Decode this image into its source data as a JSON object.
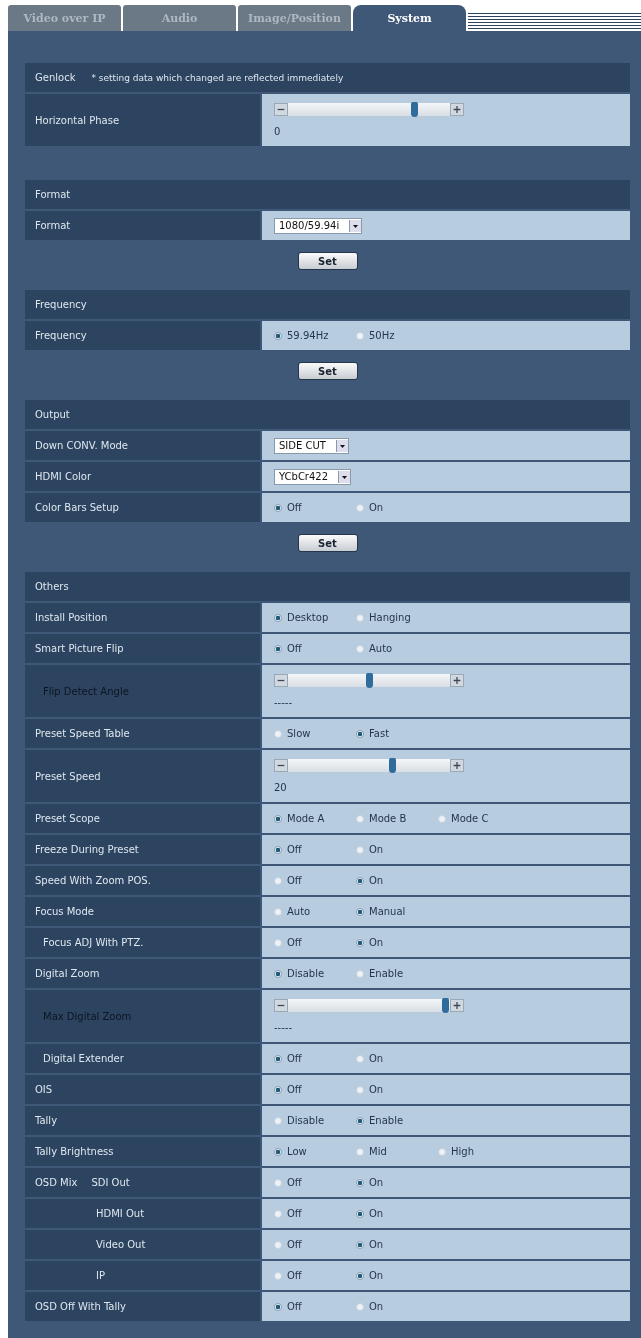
{
  "tabs": [
    {
      "label": "Video over IP",
      "selected": false
    },
    {
      "label": "Audio",
      "selected": false
    },
    {
      "label": "Image/Position",
      "selected": false
    },
    {
      "label": "System",
      "selected": true
    }
  ],
  "sections": [
    {
      "title": "Genlock",
      "note": "* setting data which changed are reflected immediately",
      "rows": [
        {
          "kind": "slider",
          "label": "Horizontal Phase",
          "disabled": false,
          "level": 0.78,
          "reading": "0"
        }
      ]
    },
    {
      "title": "Format",
      "button": "Set",
      "rows": [
        {
          "kind": "select",
          "label": "Format",
          "disabled": false,
          "value": "1080/59.94i"
        }
      ]
    },
    {
      "title": "Frequency",
      "button": "Set",
      "rows": [
        {
          "kind": "radio",
          "label": "Frequency",
          "disabled": false,
          "options": [
            {
              "label": "59.94Hz",
              "selected": true
            },
            {
              "label": "50Hz",
              "selected": false
            }
          ]
        }
      ]
    },
    {
      "title": "Output",
      "button": "Set",
      "rows": [
        {
          "kind": "select",
          "label": "Down CONV. Mode",
          "disabled": false,
          "value": "SIDE CUT"
        },
        {
          "kind": "select",
          "label": "HDMI Color",
          "disabled": false,
          "value": "YCbCr422"
        },
        {
          "kind": "radio",
          "label": "Color Bars Setup",
          "disabled": false,
          "options": [
            {
              "label": "Off",
              "selected": true
            },
            {
              "label": "On",
              "selected": false
            }
          ]
        }
      ]
    },
    {
      "title": "Others",
      "rows": [
        {
          "kind": "radio",
          "label": "Install Position",
          "disabled": false,
          "options": [
            {
              "label": "Desktop",
              "selected": true
            },
            {
              "label": "Hanging",
              "selected": false
            }
          ]
        },
        {
          "kind": "radio",
          "label": "Smart Picture Flip",
          "disabled": false,
          "options": [
            {
              "label": "Off",
              "selected": true
            },
            {
              "label": "Auto",
              "selected": false
            }
          ],
          "children": [
            {
              "kind": "slider",
              "label": "Flip Detect Angle",
              "disabled": true,
              "level": 0.5,
              "reading": "-----"
            }
          ]
        },
        {
          "kind": "radio",
          "label": "Preset Speed Table",
          "disabled": false,
          "options": [
            {
              "label": "Slow",
              "selected": false
            },
            {
              "label": "Fast",
              "selected": true
            }
          ]
        },
        {
          "kind": "slider",
          "label": "Preset Speed",
          "disabled": false,
          "level": 0.64,
          "reading": "20"
        },
        {
          "kind": "radio",
          "label": "Preset Scope",
          "disabled": false,
          "options": [
            {
              "label": "Mode A",
              "selected": true
            },
            {
              "label": "Mode B",
              "selected": false
            },
            {
              "label": "Mode C",
              "selected": false
            }
          ]
        },
        {
          "kind": "radio",
          "label": "Freeze During Preset",
          "disabled": false,
          "options": [
            {
              "label": "Off",
              "selected": true
            },
            {
              "label": "On",
              "selected": false
            }
          ]
        },
        {
          "kind": "radio",
          "label": "Speed With Zoom POS.",
          "disabled": false,
          "options": [
            {
              "label": "Off",
              "selected": false
            },
            {
              "label": "On",
              "selected": true
            }
          ]
        },
        {
          "kind": "radio",
          "label": "Focus Mode",
          "disabled": false,
          "options": [
            {
              "label": "Auto",
              "selected": false
            },
            {
              "label": "Manual",
              "selected": true
            }
          ],
          "children": [
            {
              "kind": "radio",
              "label": "Focus ADJ With PTZ.",
              "disabled": false,
              "options": [
                {
                  "label": "Off",
                  "selected": false
                },
                {
                  "label": "On",
                  "selected": true
                }
              ]
            }
          ]
        },
        {
          "kind": "radio",
          "label": "Digital Zoom",
          "disabled": false,
          "options": [
            {
              "label": "Disable",
              "selected": true
            },
            {
              "label": "Enable",
              "selected": false
            }
          ],
          "children": [
            {
              "kind": "slider",
              "label": "Max Digital Zoom",
              "disabled": true,
              "level": 0.97,
              "reading": "-----"
            },
            {
              "kind": "radio",
              "label": "Digital Extender",
              "disabled": false,
              "options": [
                {
                  "label": "Off",
                  "selected": true
                },
                {
                  "label": "On",
                  "selected": false
                }
              ]
            }
          ]
        },
        {
          "kind": "radio",
          "label": "OIS",
          "disabled": false,
          "options": [
            {
              "label": "Off",
              "selected": true
            },
            {
              "label": "On",
              "selected": false
            }
          ]
        },
        {
          "kind": "radio",
          "label": "Tally",
          "disabled": false,
          "options": [
            {
              "label": "Disable",
              "selected": false
            },
            {
              "label": "Enable",
              "selected": true
            }
          ]
        },
        {
          "kind": "radio",
          "label": "Tally Brightness",
          "disabled": false,
          "options": [
            {
              "label": "Low",
              "selected": true
            },
            {
              "label": "Mid",
              "selected": false
            },
            {
              "label": "High",
              "selected": false
            }
          ]
        },
        {
          "kind": "radio",
          "group": "OSD Mix",
          "label": "SDI Out",
          "disabled": false,
          "options": [
            {
              "label": "Off",
              "selected": false
            },
            {
              "label": "On",
              "selected": true
            }
          ],
          "children": [
            {
              "kind": "radio",
              "label": "HDMI Out",
              "disabled": false,
              "options": [
                {
                  "label": "Off",
                  "selected": false
                },
                {
                  "label": "On",
                  "selected": true
                }
              ]
            },
            {
              "kind": "radio",
              "label": "Video Out",
              "disabled": false,
              "options": [
                {
                  "label": "Off",
                  "selected": false
                },
                {
                  "label": "On",
                  "selected": true
                }
              ]
            },
            {
              "kind": "radio",
              "label": "IP",
              "disabled": false,
              "options": [
                {
                  "label": "Off",
                  "selected": false
                },
                {
                  "label": "On",
                  "selected": true
                }
              ]
            }
          ]
        },
        {
          "kind": "radio",
          "label": "OSD Off With Tally",
          "disabled": false,
          "options": [
            {
              "label": "Off",
              "selected": true
            },
            {
              "label": "On",
              "selected": false
            }
          ]
        }
      ]
    }
  ]
}
